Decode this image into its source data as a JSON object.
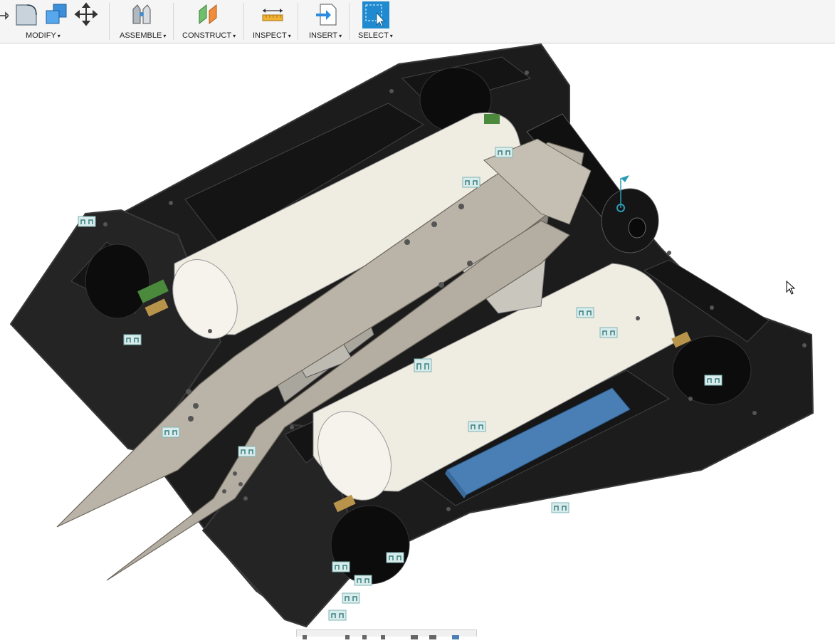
{
  "toolbar": {
    "groups": [
      {
        "id": "modify",
        "label": "MODIFY"
      },
      {
        "id": "assemble",
        "label": "ASSEMBLE"
      },
      {
        "id": "construct",
        "label": "CONSTRUCT"
      },
      {
        "id": "inspect",
        "label": "INSPECT"
      },
      {
        "id": "insert",
        "label": "INSERT"
      },
      {
        "id": "select",
        "label": "SELECT"
      }
    ],
    "caret": "▾"
  },
  "colors": {
    "toolbar_bg": "#f5f5f5",
    "chassis": "#1e1e1e",
    "chassis_edge": "#3a3a3a",
    "cylinder": "#efece2",
    "metal_plate": "#b9b3a8",
    "battery": "#4a7fb5",
    "joint_badge": "#d9ecec",
    "select_accent": "#1f8ad0"
  },
  "icons": [
    "fillet-icon",
    "shell-icon",
    "combine-icon",
    "move-icon",
    "joint-icon",
    "offset-plane-icon",
    "measure-icon",
    "insert-icon",
    "select-icon",
    "cursor-icon"
  ]
}
